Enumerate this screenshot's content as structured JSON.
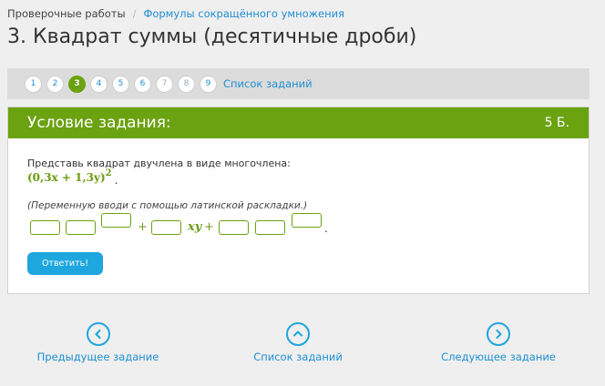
{
  "breadcrumb": {
    "item1": "Проверочные работы",
    "separator": "/",
    "item2": "Формулы сокращённого умножения"
  },
  "page_title": "3. Квадрат суммы (десятичные дроби)",
  "task_nav": {
    "numbers": [
      "1",
      "2",
      "3",
      "4",
      "5",
      "6",
      "7",
      "8",
      "9"
    ],
    "active_index": 3,
    "list_link": "Список заданий"
  },
  "card": {
    "header_title": "Условие задания:",
    "points": "5 Б.",
    "instruction": "Представь квадрат двучлена в виде многочлена:",
    "expression": "(0,3x + 1,3y)",
    "exponent": "2",
    "expression_end": ".",
    "hint": "(Переменную вводи с помощью латинской раскладки.)",
    "answer": {
      "plus": "+",
      "var_xy": "xy",
      "plus2": "+",
      "end": "."
    },
    "submit_label": "Ответить!"
  },
  "bottom_nav": {
    "prev": "Предыдущее задание",
    "list": "Список заданий",
    "next": "Следующее задание"
  },
  "colors": {
    "accent_green": "#6aa210",
    "accent_blue": "#1ea6df",
    "link_blue": "#1e8fd3"
  }
}
